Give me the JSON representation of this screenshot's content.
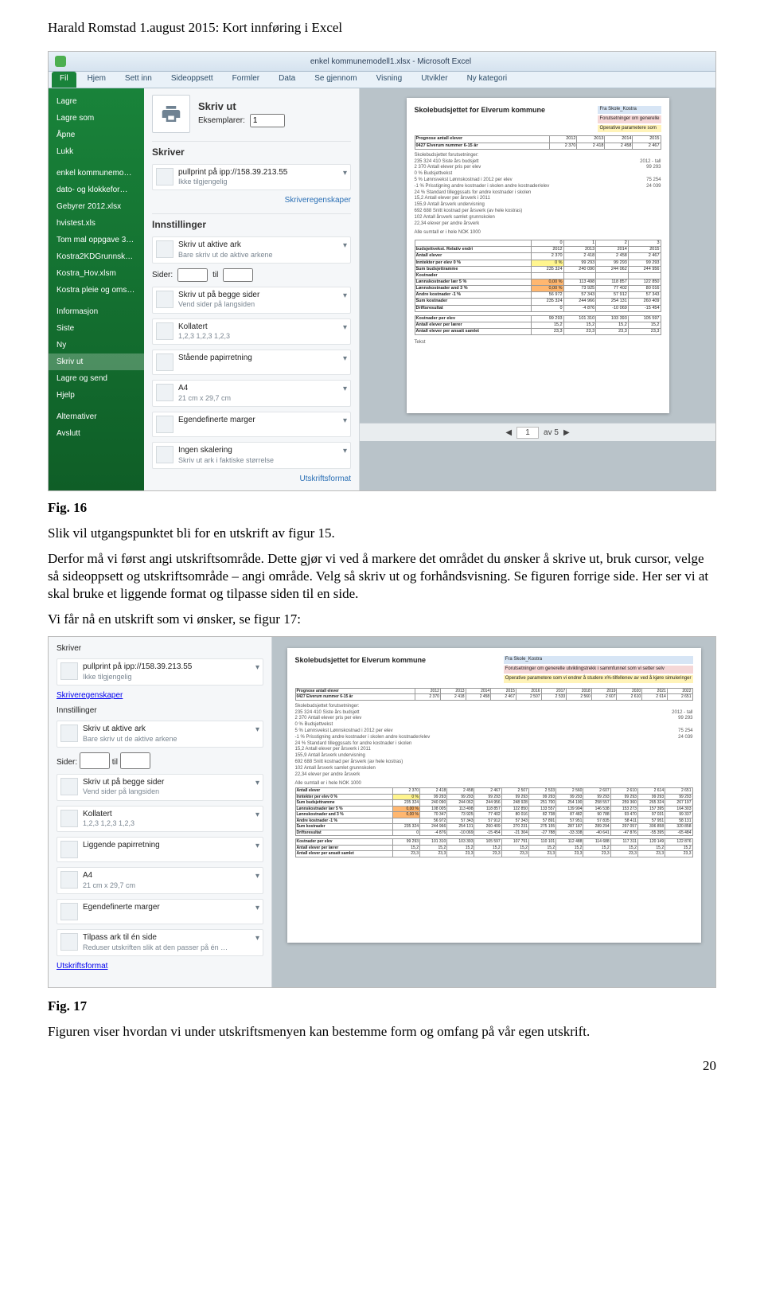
{
  "doc": {
    "header": "Harald Romstad 1.august  2015: Kort innføring i Excel",
    "fig16_label": "Fig. 16",
    "fig16_caption": "Slik vil utgangspunktet bli for en utskrift av figur 15.",
    "para1": "Derfor må vi først angi utskriftsområde. Dette gjør vi ved å markere det området du ønsker å skrive ut, bruk cursor, velge så sideoppsett og utskriftsområde – angi område. Velg så skriv ut og forhåndsvisning. Se figuren forrige side. Her ser vi at skal bruke et liggende format og tilpasse siden til en side.",
    "para2": "Vi får nå en utskrift som vi ønsker, se figur 17:",
    "fig17_label": "Fig. 17",
    "fig17_caption": "Figuren viser hvordan vi under utskriftsmenyen kan bestemme form og omfang på vår egen utskrift.",
    "page_number": "20"
  },
  "excel": {
    "window_title": "enkel kommunemodell1.xlsx - Microsoft Excel",
    "tabs": [
      "Fil",
      "Hjem",
      "Sett inn",
      "Sideoppsett",
      "Formler",
      "Data",
      "Se gjennom",
      "Visning",
      "Utvikler",
      "Ny kategori"
    ],
    "nav": {
      "page_box": "1",
      "of_text": "av 5"
    }
  },
  "filemenu": {
    "items": [
      "Lagre",
      "Lagre som",
      "Åpne",
      "Lukk",
      "enkel kommunemo…",
      "dato- og klokkefor…",
      "Gebyrer 2012.xlsx",
      "hvistest.xls",
      "Tom mal oppgave 3…",
      "Kostra2KDGrunnsk…",
      "Kostra_Hov.xlsm",
      "Kostra pleie og oms…",
      "Informasjon",
      "Siste",
      "Ny",
      "Skriv ut",
      "Lagre og send",
      "Hjelp",
      "Alternativer",
      "Avslutt"
    ],
    "selected": "Skriv ut"
  },
  "print1": {
    "print_label": "Skriv ut",
    "copies_label": "Eksemplarer:",
    "copies_value": "1",
    "printer_title": "Skriver",
    "printer_name": "pullprint på ipp://158.39.213.55",
    "printer_status": "Ikke tilgjengelig",
    "printer_props": "Skriveregenskaper",
    "settings_title": "Innstillinger",
    "s_active": {
      "t": "Skriv ut aktive ark",
      "s": "Bare skriv ut de aktive arkene"
    },
    "pages_label": "Sider:",
    "pages_to": "til",
    "s_twoside": {
      "t": "Skriv ut på begge sider",
      "s": "Vend sider på langsiden"
    },
    "s_collate": {
      "t": "Kollatert",
      "s": "1,2,3   1,2,3   1,2,3"
    },
    "s_orient": "Stående papirretning",
    "s_paper": {
      "t": "A4",
      "s": "21 cm x 29,7 cm"
    },
    "s_margins": "Egendefinerte marger",
    "s_scaling": {
      "t": "Ingen skalering",
      "s": "Skriv ut ark i faktiske størrelse"
    },
    "print_format": "Utskriftsformat"
  },
  "print2": {
    "printer_title": "Skriver",
    "printer_name": "pullprint på ipp://158.39.213.55",
    "printer_status": "Ikke tilgjengelig",
    "printer_props": "Skriveregenskaper",
    "settings_title": "Innstillinger",
    "s_active": {
      "t": "Skriv ut aktive ark",
      "s": "Bare skriv ut de aktive arkene"
    },
    "pages_label": "Sider:",
    "pages_to": "til",
    "s_twoside": {
      "t": "Skriv ut på begge sider",
      "s": "Vend sider på langsiden"
    },
    "s_collate": {
      "t": "Kollatert",
      "s": "1,2,3   1,2,3   1,2,3"
    },
    "s_orient": "Liggende papirretning",
    "s_paper": {
      "t": "A4",
      "s": "21 cm x 29,7 cm"
    },
    "s_margins": "Egendefinerte marger",
    "s_fit": {
      "t": "Tilpass ark til én side",
      "s": "Reduser utskriften slik at den passer på én …"
    },
    "print_format": "Utskriftsformat"
  },
  "preview": {
    "title": "Skolebudsjettet for Elverum kommune",
    "tag1": "Fra Skole_Kostra",
    "tag2": "Forutsetninger om generelle",
    "tag3": "Operative parametere som",
    "line1": "Prognose antall elever",
    "yrs": [
      "2012",
      "2013",
      "2014",
      "2015"
    ],
    "line2": "0427 Elverum    nummer    6-15 år",
    "row1": [
      "2 370",
      "2 418",
      "2 458",
      "2 467"
    ],
    "h2": "Skolebudsjettet forutsetninger:",
    "budget": "235 324 410  Siste års budsjett",
    "ant_elever": "2 370  Antall elever        pris per elev",
    "year_col": "2012 - tall",
    "pris": "99 293",
    "bv": "0 % Budsjettvekst",
    "lv": "5 % Lønnsvekst        Lønnskostnad i 2012 per elev",
    "lv_v": "75 254",
    "pris2": "-1 %  Prisstigning andre kostnader i skolen       andre kostnader/elev",
    "pris2_v": "24 039",
    "std": "24 %  Standard tilleggssats for andre kostnader i skolen",
    "ape": "15,2  Antall elever per årsverk i 2011",
    "aau": "155,9  Antall årsverk undervisning",
    "ska": "692 688  Snitt kostnad per årsverk  (av hele kostras)",
    "ios": "102  Antall årsverk samlet grunnskolen",
    "epa": "22,34  elever per andre  årsverk",
    "sumrow": "Alle sumtall er i hele NOK        1000",
    "bvc": [
      "0",
      "1",
      "2",
      "3"
    ],
    "bvy": [
      "2012",
      "2013",
      "2014",
      "2015"
    ],
    "labels": {
      "bvrel": "budsjettvekst. Relativ endri",
      "ant": "Antall elever",
      "ipe": "Inntekter per elev     0 %",
      "sbr": "Sum budsjettramme",
      "kost": "Kostnader",
      "lkl": "Lønnskostnader lær     5 %",
      "lka": "Lønnskostnader and    3 %",
      "ak": "Andre kostnader       -1 %",
      "sk": "Sum kostnader",
      "dr": "Driftsresultat",
      "kpe": "Kostnader per elev",
      "apl": "Antall elever per lærer",
      "apa": "Antall elever per ansatt samlet",
      "txt": "Tekst"
    },
    "rows": {
      "ant": [
        "2 370",
        "2 418",
        "2 458",
        "2 467"
      ],
      "ipe": [
        "99 293",
        "99 293",
        "99 293",
        "99 293"
      ],
      "sbr": [
        "235 324",
        "240 090",
        "244 062",
        "244 956"
      ],
      "lkl": [
        "108 005",
        "113 498",
        "118 857",
        "122 850"
      ],
      "lka": [
        "70 347",
        "73 925",
        "77 402",
        "80 016"
      ],
      "ak": [
        "56 972",
        "57 343",
        "57 912",
        "57 343"
      ],
      "sk": [
        "235 324",
        "244 966",
        "254 131",
        "260 409"
      ],
      "dr": [
        "0",
        "-4 876",
        "-10 069",
        "-15 454"
      ],
      "kpe": [
        "99 293",
        "101 310",
        "103 393",
        "105 597"
      ],
      "apl": [
        "15,2",
        "15,2",
        "15,2",
        "15,2"
      ],
      "apa": [
        "23,3",
        "23,3",
        "23,3",
        "23,3"
      ]
    },
    "pct0": "0 %",
    "pct1": "0,00 %"
  },
  "preview2": {
    "title": "Skolebudsjettet for Elverum kommune",
    "tag1": "Fra Skole_Kostra",
    "tag2": "Forutsetninger om generelle utviklingstrekk i sammfunnet som vi setter selv",
    "tag3": "Operative parametere som vi endrer å studere x%-tilfellenev av ved å kjøre simuleringer",
    "yrshdr": [
      "2012",
      "2013",
      "2014",
      "2015",
      "2016",
      "2017",
      "2018",
      "2019",
      "2020",
      "2021",
      "2022"
    ],
    "elever": [
      "2 370",
      "2 418",
      "2 458",
      "2 467",
      "2 507",
      "2 533",
      "2 560",
      "2 607",
      "2 610",
      "2 614",
      "2 651"
    ]
  }
}
